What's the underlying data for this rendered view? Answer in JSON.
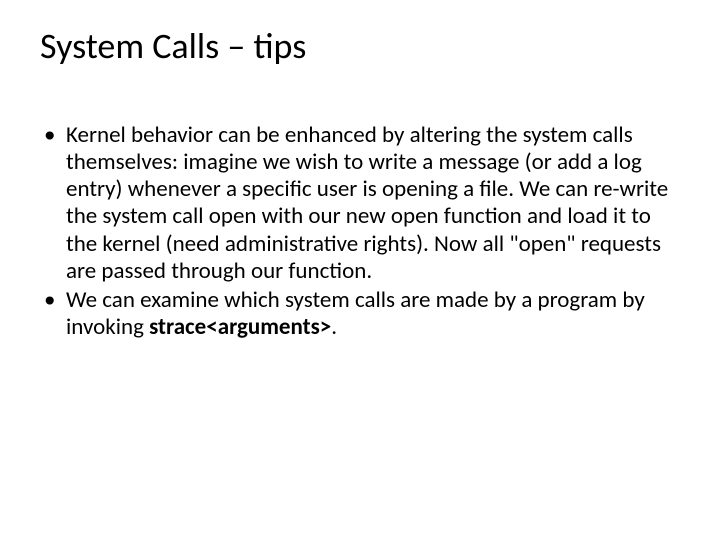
{
  "title": "System Calls – tips",
  "bullets": [
    {
      "text_before": "Kernel behavior can be enhanced by altering the system calls themselves: imagine we wish to write a message (or add a log entry) whenever a specific user is opening a file. We can re-write the system call open with our new open function and load it to the kernel (need administrative rights). Now all \"open\" requests are passed through our function.",
      "bold": "",
      "text_after": ""
    },
    {
      "text_before": "We can examine which system calls are made by a program by invoking ",
      "bold": "strace<arguments>",
      "text_after": "."
    }
  ]
}
